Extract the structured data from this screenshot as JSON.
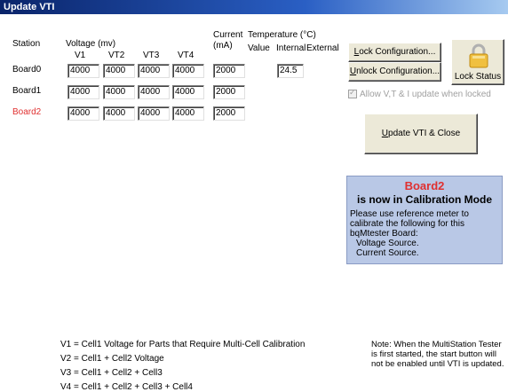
{
  "window": {
    "title": "Update VTI"
  },
  "headers": {
    "station": "Station",
    "voltage": "Voltage (mv)",
    "v1": "V1",
    "vt2": "VT2",
    "vt3": "VT3",
    "vt4": "VT4",
    "current": "Current",
    "current_unit": "(mA)",
    "temperature": "Temperature (°C)",
    "value": "Value",
    "internal": "Internal",
    "external": "External"
  },
  "boards": [
    {
      "name": "Board0",
      "v1": "4000",
      "vt2": "4000",
      "vt3": "4000",
      "vt4": "4000",
      "current": "2000",
      "temp_internal": "24.5"
    },
    {
      "name": "Board1",
      "v1": "4000",
      "vt2": "4000",
      "vt3": "4000",
      "vt4": "4000",
      "current": "2000"
    },
    {
      "name": "Board2",
      "v1": "4000",
      "vt2": "4000",
      "vt3": "4000",
      "vt4": "4000",
      "current": "2000"
    }
  ],
  "buttons": {
    "lock_first": "L",
    "lock_rest": "ock Configuration...",
    "unlock_first": "U",
    "unlock_rest": "nlock Configuration...",
    "update_first": "U",
    "update_rest": "pdate VTI & Close",
    "lock_status": "Lock Status"
  },
  "allow_checkbox": {
    "label": "Allow V,T & I update when locked",
    "checked": true
  },
  "calibration": {
    "board": "Board2",
    "headline": "is now in Calibration Mode",
    "message": "Please use reference meter to calibrate the following for this bqMtester Board:",
    "item1": "Voltage Source.",
    "item2": "Current Source."
  },
  "notes": {
    "v1": "V1 = Cell1 Voltage for Parts that Require Multi-Cell Calibration",
    "v2": "V2 = Cell1 + Cell2 Voltage",
    "v3": "V3 = Cell1 + Cell2 + Cell3",
    "v4": "V4 = Cell1 + Cell2 + Cell3 + Cell4",
    "tester_note": "Note: When the MultiStation Tester is first started, the start button will not be enabled until VTI is updated."
  },
  "colors": {
    "title_bar": "#0a246a",
    "calibration_board": "#e03030",
    "info_background": "#b9c8e6"
  }
}
